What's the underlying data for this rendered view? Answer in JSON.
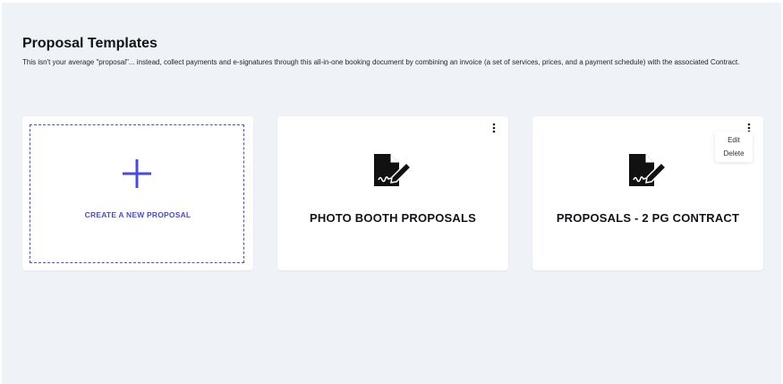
{
  "page": {
    "title": "Proposal Templates",
    "description": "This isn't your average \"proposal\"... instead, collect payments and e-signatures through this all-in-one booking document by combining an invoice (a set of services, prices, and a payment schedule) with the associated Contract."
  },
  "create_card": {
    "label": "CREATE A NEW PROPOSAL",
    "icon": "plus-icon"
  },
  "templates": [
    {
      "title": "PHOTO BOOTH PROPOSALS",
      "icon": "signed-document-icon"
    },
    {
      "title": "PROPOSALS - 2 PG CONTRACT",
      "icon": "signed-document-icon"
    }
  ],
  "context_menu": {
    "items": [
      "Edit",
      "Delete"
    ]
  },
  "colors": {
    "background": "#eff2f7",
    "accent": "#4d4bcb",
    "card": "#ffffff"
  }
}
